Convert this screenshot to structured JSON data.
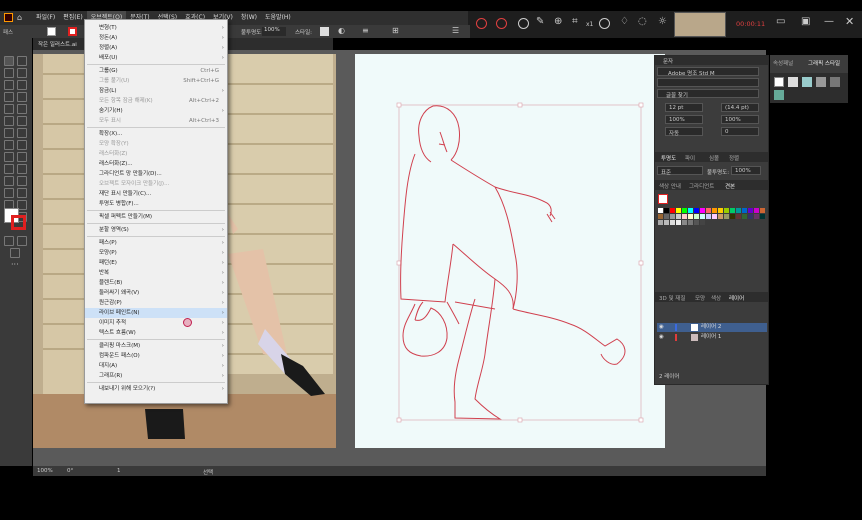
{
  "menubar": {
    "items": [
      "파일(F)",
      "편집(E)",
      "오브젝트(O)",
      "문자(T)",
      "선택(S)",
      "효과(C)",
      "보기(V)",
      "창(W)",
      "도움말(H)"
    ],
    "active_index": 2
  },
  "recorder": {
    "timer": "00:00:11",
    "counter": "x1"
  },
  "controlbar": {
    "opacity_label": "불투명도:",
    "opacity_value": "100%",
    "style_label": "스타일:"
  },
  "doc_tab": {
    "title": "작은 일러스트.ai"
  },
  "object_menu": {
    "items": [
      {
        "label": "변형(T)",
        "submenu": true
      },
      {
        "label": "정돈(A)",
        "submenu": true
      },
      {
        "label": "정렬(A)",
        "submenu": true
      },
      {
        "label": "배포(U)",
        "submenu": true
      },
      {
        "sep": true
      },
      {
        "label": "그룹(G)",
        "shortcut": "Ctrl+G"
      },
      {
        "label": "그룹 풀기(U)",
        "shortcut": "Shift+Ctrl+G",
        "disabled": true
      },
      {
        "label": "잠금(L)",
        "submenu": true
      },
      {
        "label": "모든 항목 잠금 해제(K)",
        "shortcut": "Alt+Ctrl+2",
        "disabled": true
      },
      {
        "label": "숨기기(H)",
        "submenu": true
      },
      {
        "label": "모두 표시",
        "shortcut": "Alt+Ctrl+3",
        "disabled": true
      },
      {
        "sep": true
      },
      {
        "label": "확장(X)..."
      },
      {
        "label": "모양 확장(Y)",
        "disabled": true
      },
      {
        "label": "래스터화(Z)",
        "disabled": true
      },
      {
        "label": "래스터화(Z)..."
      },
      {
        "label": "그라디언트 망 만들기(D)..."
      },
      {
        "label": "오브젝트 모자이크 만들기(J)...",
        "disabled": true
      },
      {
        "label": "재단 표시 만들기(C)..."
      },
      {
        "label": "투명도 병합(F)..."
      },
      {
        "sep": true
      },
      {
        "label": "픽셀 퍼펙트 만들기(M)"
      },
      {
        "sep": true
      },
      {
        "label": "분할 영역(S)",
        "submenu": true
      },
      {
        "sep": true
      },
      {
        "label": "패스(P)",
        "submenu": true
      },
      {
        "label": "모양(P)",
        "submenu": true
      },
      {
        "label": "패턴(E)",
        "submenu": true
      },
      {
        "label": "반복",
        "submenu": true
      },
      {
        "label": "블렌드(B)",
        "submenu": true
      },
      {
        "label": "둘러싸기 왜곡(V)",
        "submenu": true
      },
      {
        "label": "원근감(P)",
        "submenu": true
      },
      {
        "label": "라이브 페인트(N)",
        "submenu": true,
        "highlighted": true
      },
      {
        "label": "이미지 추적",
        "submenu": true
      },
      {
        "label": "텍스트 흐름(W)",
        "submenu": true
      },
      {
        "sep": true
      },
      {
        "label": "클리핑 마스크(M)",
        "submenu": true
      },
      {
        "label": "컴파운드 패스(O)",
        "submenu": true
      },
      {
        "label": "대지(A)",
        "submenu": true
      },
      {
        "label": "그래프(R)",
        "submenu": true
      },
      {
        "sep": true
      },
      {
        "label": "내보내기 위해 모으기(?)",
        "submenu": true
      }
    ]
  },
  "char_panel": {
    "title": "문자",
    "font": "Adobe 명조 Std M",
    "search_hint": "글꼴 찾기",
    "size": "12 pt",
    "leading": "(14.4 pt)",
    "scale_h": "100%",
    "scale_v": "100%",
    "tracking": "자동",
    "kerning": "0"
  },
  "transparency_panel": {
    "tabs": [
      "투명도",
      "파이",
      "심볼",
      "정렬"
    ],
    "mode": "표준",
    "opacity_label": "불투명도:",
    "opacity": "100%"
  },
  "swatch_panel": {
    "tabs": [
      "색상 안내",
      "그라디언트",
      "견본"
    ]
  },
  "layers_panel": {
    "tabs": [
      "3D 및 재질",
      "모양",
      "색상",
      "레이어"
    ],
    "layers": [
      {
        "name": "레이어 2",
        "color": "#3b6ae0",
        "selected": true
      },
      {
        "name": "레이어 1",
        "color": "#e03b3b",
        "selected": false
      }
    ],
    "footer": "2 레이어"
  },
  "right_panel": {
    "tabs": [
      "속성패널",
      "그래픽 스타일"
    ]
  },
  "statusbar": {
    "zoom": "100%",
    "angle": "0°",
    "page": "1",
    "mode": "선택"
  },
  "colors": {
    "menu_bg": "#f0f0f0",
    "highlight": "#cde1f7",
    "artboard": "#f0fafa",
    "line_art": "#d0404e"
  }
}
